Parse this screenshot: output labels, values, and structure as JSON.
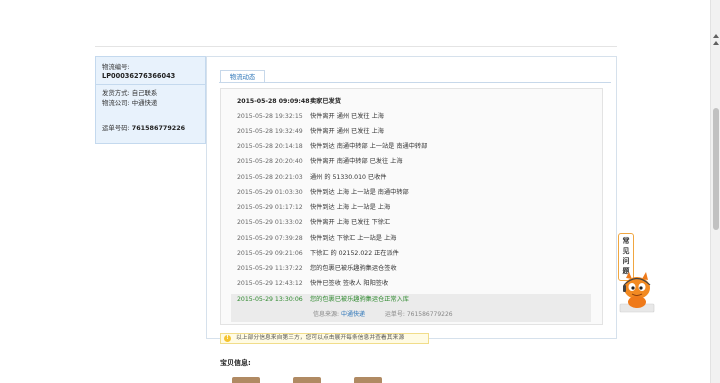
{
  "order": {
    "tracking_label": "物流编号:",
    "tracking_value": "LP00036276366043",
    "ship_method": "发货方式: 自己联系",
    "carrier": "物流公司: 中通快递",
    "waybill_label": "运单号码:",
    "waybill_value": "761586779226"
  },
  "tab": {
    "label": "物流动态"
  },
  "events": [
    {
      "time": "2015-05-28 09:09:48",
      "desc": "卖家已发货"
    },
    {
      "time": "2015-05-28 19:32:15",
      "desc": "快件离开 通州 已发往 上海"
    },
    {
      "time": "2015-05-28 19:32:49",
      "desc": "快件离开 通州 已发往 上海"
    },
    {
      "time": "2015-05-28 20:14:18",
      "desc": "快件到达 南通中转部 上一站是 南通中转部"
    },
    {
      "time": "2015-05-28 20:20:40",
      "desc": "快件离开 南通中转部 已发往 上海"
    },
    {
      "time": "2015-05-28 20:21:03",
      "desc": "通州 的 51330.010 已收件"
    },
    {
      "time": "2015-05-29 01:03:30",
      "desc": "快件到达 上海 上一站是 南通中转部"
    },
    {
      "time": "2015-05-29 01:17:12",
      "desc": "快件到达 上海 上一站是 上海"
    },
    {
      "time": "2015-05-29 01:33:02",
      "desc": "快件离开 上海 已发往 下徐汇"
    },
    {
      "time": "2015-05-29 07:39:28",
      "desc": "快件到达 下徐汇 上一站是 上海"
    },
    {
      "time": "2015-05-29 09:21:06",
      "desc": "下徐汇 的 02152.022 正在派件"
    },
    {
      "time": "2015-05-29 11:37:22",
      "desc": "您的包裹已被乐趣驹集运仓签收"
    },
    {
      "time": "2015-05-29 12:43:12",
      "desc": "快件已签收 签收人 阳阳签收"
    },
    {
      "time": "2015-05-29 13:30:06",
      "desc": "您的包裹已被乐趣驹集运仓正常入库"
    }
  ],
  "source": {
    "label": "信息来源:",
    "link": "中通快递",
    "waybill": "运单号: 761586779226"
  },
  "notice": {
    "icon": "lightbulb-icon",
    "text": "以上部分信息来自第三方，您可以点击展开每条信息并查看其来源"
  },
  "section_title": "宝贝信息:",
  "faq": {
    "chars": [
      "常",
      "见",
      "问",
      "题"
    ]
  },
  "colors": {
    "accent_blue": "#2e76b8",
    "latest_green": "#2f8a2f",
    "faq_border": "#f0a640"
  }
}
